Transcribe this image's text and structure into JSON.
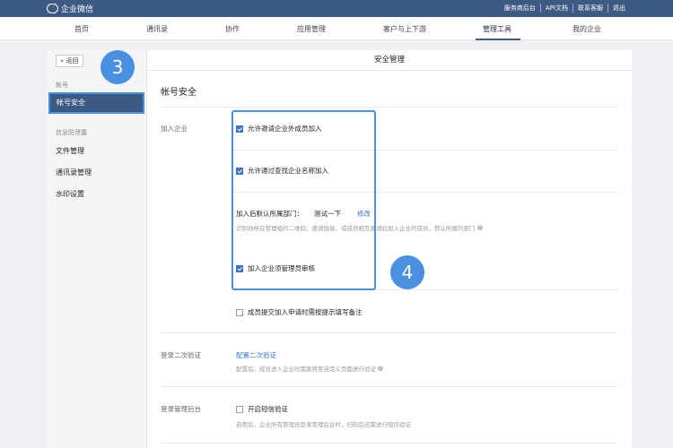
{
  "topbar": {
    "brand": "企业微信",
    "links": [
      "服务商后台",
      "API文档",
      "联系客服",
      "退出"
    ]
  },
  "nav": {
    "items": [
      "首页",
      "通讯录",
      "协作",
      "应用管理",
      "客户与上下游",
      "管理工具",
      "我的企业"
    ],
    "active": "管理工具"
  },
  "sidebar": {
    "back": "« 返回",
    "group1": "帐号",
    "active_item": "帐号安全",
    "group2": "信息防泄露",
    "items": [
      "文件管理",
      "通讯录管理",
      "水印设置"
    ]
  },
  "main": {
    "header": "安全管理",
    "section_title": "帐号安全",
    "join": {
      "label": "加入企业",
      "opt1": "允许邀请企业外成员加入",
      "opt2": "允许通过查找企业名称加入",
      "dept_label": "加入后默认所属部门：",
      "dept_value": "测试一下",
      "dept_edit": "修改",
      "dept_hint": "识别你所在管理组的二维码、邀请链接、或成员相互邀请后加入企业的成员，默认所属的部门",
      "opt3": "加入企业须管理员审核",
      "opt4": "成员提交加入申请时需按提示填写备注"
    },
    "two_factor": {
      "label": "登录二次验证",
      "link": "配置二次验证",
      "hint": "配置后，成员进入企业时需跳转至自定义页面进行验证"
    },
    "admin_login": {
      "label": "登录管理后台",
      "opt": "开启短信验证",
      "hint": "启用后，企业所有管理员登录管理后台时，扫码后还需进行短信验证"
    }
  },
  "annotations": {
    "badge3": "3",
    "badge4": "4",
    "accent": "#4a90e2"
  }
}
